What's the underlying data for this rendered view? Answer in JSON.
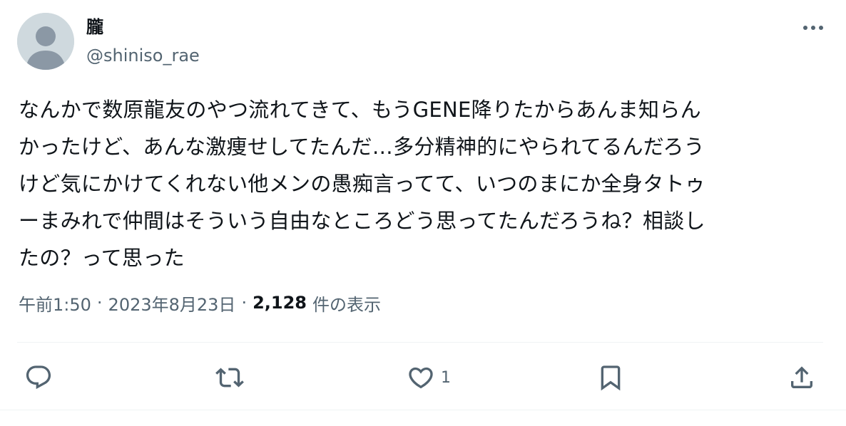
{
  "author": {
    "display_name": "朧",
    "handle": "@shiniso_rae",
    "avatar_icon": "default-user-icon"
  },
  "tweet": {
    "text": "なんかで数原龍友のやつ流れてきて、もうGENE降りたからあんま知らん\nかったけど、あんな激痩せしてたんだ…多分精神的にやられてるんだろう\nけど気にかけてくれない他メンの愚痴言ってて、いつのまにか全身タトゥ\nーまみれで仲間はそういう自由なところどう思ってたんだろうね？相談し\nたの？って思った"
  },
  "meta": {
    "time": "午前1:50",
    "date": "2023年8月23日",
    "separator": "·",
    "views_count": "2,128",
    "views_label": "件の表示"
  },
  "actions": {
    "reply_icon": "reply-icon",
    "retweet_icon": "retweet-icon",
    "like_icon": "heart-icon",
    "like_count": "1",
    "bookmark_icon": "bookmark-icon",
    "share_icon": "share-icon",
    "more_icon": "more-dots-icon"
  },
  "colors": {
    "text_primary": "#0f1419",
    "text_secondary": "#536471",
    "divider": "#eff3f4",
    "avatar_bg": "#cfd9de",
    "avatar_fg": "#8b98a5"
  }
}
